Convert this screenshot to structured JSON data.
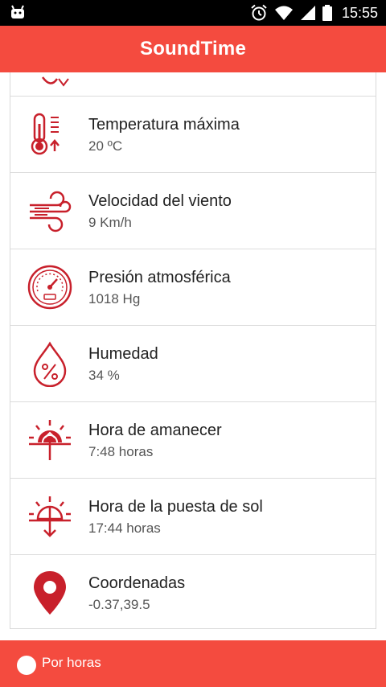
{
  "status_bar": {
    "time": "15:55"
  },
  "app": {
    "title": "SoundTime"
  },
  "colors": {
    "accent": "#f44b3f",
    "icon": "#c8202b"
  },
  "items": [
    {
      "icon": "thermometer-icon",
      "label": "Temperatura máxima",
      "value": "20 ºC"
    },
    {
      "icon": "wind-icon",
      "label": "Velocidad del viento",
      "value": "9 Km/h"
    },
    {
      "icon": "barometer-icon",
      "label": "Presión atmosférica",
      "value": "1018 Hg"
    },
    {
      "icon": "humidity-icon",
      "label": "Humedad",
      "value": "34 %"
    },
    {
      "icon": "sunrise-icon",
      "label": "Hora de amanecer",
      "value": "7:48 horas"
    },
    {
      "icon": "sunset-icon",
      "label": "Hora de la puesta de sol",
      "value": "17:44 horas"
    },
    {
      "icon": "location-pin-icon",
      "label": "Coordenadas",
      "value": "-0.37,39.5"
    }
  ],
  "bottom": {
    "label": "Por horas"
  }
}
